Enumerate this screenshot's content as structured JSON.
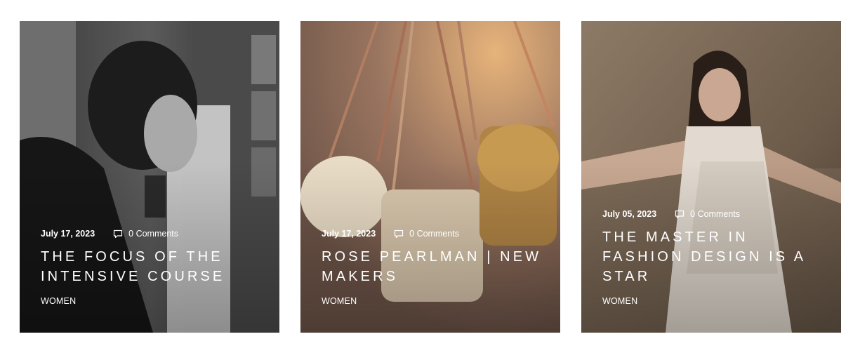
{
  "posts": [
    {
      "date": "July 17, 2023",
      "comments": "0 Comments",
      "title": "THE FOCUS OF THE INTENSIVE COURSE",
      "category": "WOMEN"
    },
    {
      "date": "July 17, 2023",
      "comments": "0 Comments",
      "title": "ROSE PEARLMAN | NEW MAKERS",
      "category": "WOMEN"
    },
    {
      "date": "July 05, 2023",
      "comments": "0 Comments",
      "title": "THE MASTER IN FASHION DESIGN IS A STAR",
      "category": "WOMEN"
    }
  ],
  "icons": {
    "comment": "comment-icon"
  }
}
